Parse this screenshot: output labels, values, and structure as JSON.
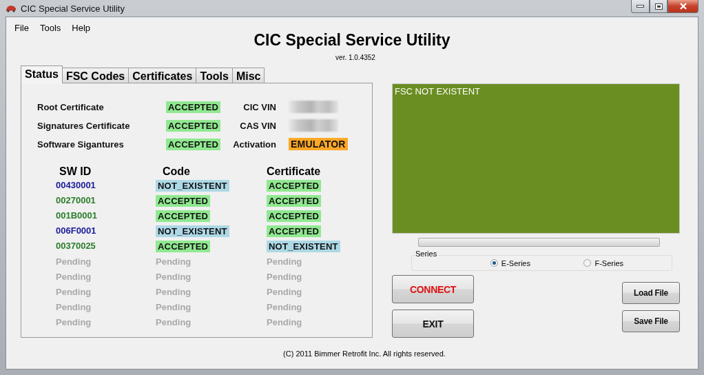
{
  "window": {
    "title": "CIC Special Service Utility"
  },
  "menu": [
    "File",
    "Tools",
    "Help"
  ],
  "header": {
    "title": "CIC Special Service Utility",
    "version": "ver. 1.0.4352"
  },
  "tabs": [
    {
      "label": "Status",
      "selected": true
    },
    {
      "label": "FSC Codes",
      "selected": false
    },
    {
      "label": "Certificates",
      "selected": false
    },
    {
      "label": "Tools",
      "selected": false
    },
    {
      "label": "Misc",
      "selected": false
    }
  ],
  "status_summary": [
    {
      "label": "Root Certificate",
      "status": {
        "text": "ACCEPTED",
        "kind": "accepted"
      },
      "field_label": "CIC VIN",
      "field": {
        "kind": "blurred"
      }
    },
    {
      "label": "Signatures Certificate",
      "status": {
        "text": "ACCEPTED",
        "kind": "accepted"
      },
      "field_label": "CAS VIN",
      "field": {
        "kind": "blurred"
      }
    },
    {
      "label": "Software Sigantures",
      "status": {
        "text": "ACCEPTED",
        "kind": "accepted"
      },
      "field_label": "Activation",
      "field": {
        "kind": "emulator",
        "text": "EMULATOR"
      }
    }
  ],
  "sw_table": {
    "columns": [
      "SW ID",
      "Code",
      "Certificate"
    ],
    "rows": [
      [
        {
          "text": "00430001",
          "kind": "id",
          "color": "#1a1a9c"
        },
        {
          "text": "NOT_EXISTENT",
          "kind": "not_existent"
        },
        {
          "text": "ACCEPTED",
          "kind": "accepted"
        }
      ],
      [
        {
          "text": "00270001",
          "kind": "id",
          "color": "#2a7d2a"
        },
        {
          "text": "ACCEPTED",
          "kind": "accepted"
        },
        {
          "text": "ACCEPTED",
          "kind": "accepted"
        }
      ],
      [
        {
          "text": "001B0001",
          "kind": "id",
          "color": "#2a7d2a"
        },
        {
          "text": "ACCEPTED",
          "kind": "accepted"
        },
        {
          "text": "ACCEPTED",
          "kind": "accepted"
        }
      ],
      [
        {
          "text": "006F0001",
          "kind": "id",
          "color": "#1a1a9c"
        },
        {
          "text": "NOT_EXISTENT",
          "kind": "not_existent"
        },
        {
          "text": "ACCEPTED",
          "kind": "accepted"
        }
      ],
      [
        {
          "text": "00370025",
          "kind": "id",
          "color": "#2a7d2a"
        },
        {
          "text": "ACCEPTED",
          "kind": "accepted"
        },
        {
          "text": "NOT_EXISTENT",
          "kind": "not_existent"
        }
      ],
      [
        {
          "text": "Pending",
          "kind": "pending"
        },
        {
          "text": "Pending",
          "kind": "pending"
        },
        {
          "text": "Pending",
          "kind": "pending"
        }
      ],
      [
        {
          "text": "Pending",
          "kind": "pending"
        },
        {
          "text": "Pending",
          "kind": "pending"
        },
        {
          "text": "Pending",
          "kind": "pending"
        }
      ],
      [
        {
          "text": "Pending",
          "kind": "pending"
        },
        {
          "text": "Pending",
          "kind": "pending"
        },
        {
          "text": "Pending",
          "kind": "pending"
        }
      ],
      [
        {
          "text": "Pending",
          "kind": "pending"
        },
        {
          "text": "Pending",
          "kind": "pending"
        },
        {
          "text": "Pending",
          "kind": "pending"
        }
      ],
      [
        {
          "text": "Pending",
          "kind": "pending"
        },
        {
          "text": "Pending",
          "kind": "pending"
        },
        {
          "text": "Pending",
          "kind": "pending"
        }
      ]
    ]
  },
  "output": {
    "text": "FSC NOT EXISTENT"
  },
  "progress": {
    "level": 0
  },
  "series": {
    "label": "Series",
    "options": [
      {
        "label": "E-Series",
        "selected": true
      },
      {
        "label": "F-Series",
        "selected": false
      }
    ]
  },
  "actions": [
    {
      "label": "CONNECT",
      "kind": "primary"
    },
    {
      "label": "EXIT",
      "kind": "default"
    }
  ],
  "file_buttons": [
    "Load File",
    "Save File"
  ],
  "footer": "(C) 2011 Bimmer Retrofit Inc. All rights reserved."
}
